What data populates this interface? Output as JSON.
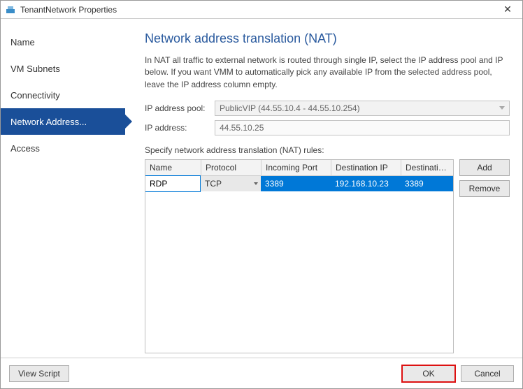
{
  "window": {
    "title": "TenantNetwork Properties"
  },
  "sidebar": {
    "items": [
      {
        "label": "Name"
      },
      {
        "label": "VM Subnets"
      },
      {
        "label": "Connectivity"
      },
      {
        "label": "Network Address..."
      },
      {
        "label": "Access"
      }
    ],
    "selected_index": 3
  },
  "content": {
    "heading": "Network address translation (NAT)",
    "description": "In NAT all traffic to external network is routed through single IP, select the IP address pool and IP below. If you want VMM to automatically pick any available IP from the selected address pool, leave the IP address column empty.",
    "ip_pool_label": "IP address pool:",
    "ip_pool_value": "PublicVIP (44.55.10.4 - 44.55.10.254)",
    "ip_addr_label": "IP address:",
    "ip_addr_value": "44.55.10.25",
    "rules_label": "Specify network address translation (NAT) rules:",
    "columns": {
      "name": "Name",
      "protocol": "Protocol",
      "incoming": "Incoming Port",
      "destip": "Destination IP",
      "destport": "Destination P..."
    },
    "rows": [
      {
        "name": "RDP",
        "protocol": "TCP",
        "incoming": "3389",
        "destip": "192.168.10.23",
        "destport": "3389"
      }
    ],
    "add_label": "Add",
    "remove_label": "Remove"
  },
  "footer": {
    "view_script": "View Script",
    "ok": "OK",
    "cancel": "Cancel"
  }
}
